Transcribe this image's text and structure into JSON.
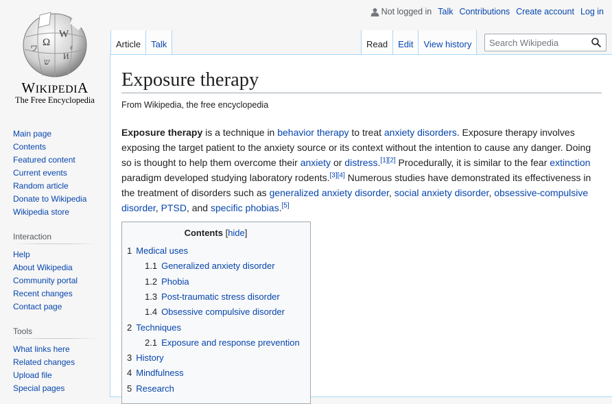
{
  "logo": {
    "wordmark_big": "Wikipedia",
    "wordmark_first": "W",
    "wordmark_rest": "IKIPEDI",
    "wordmark_last": "A",
    "tagline": "The Free Encyclopedia",
    "icon": "wikipedia-globe-icon"
  },
  "personal": {
    "not_logged_in": "Not logged in",
    "talk": "Talk",
    "contributions": "Contributions",
    "create_account": "Create account",
    "log_in": "Log in",
    "icon": "user-icon"
  },
  "tabs": {
    "article": "Article",
    "talk": "Talk",
    "read": "Read",
    "edit": "Edit",
    "view_history": "View history"
  },
  "search": {
    "placeholder": "Search Wikipedia",
    "icon": "search-icon"
  },
  "sidebar": {
    "navigation": [
      "Main page",
      "Contents",
      "Featured content",
      "Current events",
      "Random article",
      "Donate to Wikipedia",
      "Wikipedia store"
    ],
    "interaction_heading": "Interaction",
    "interaction": [
      "Help",
      "About Wikipedia",
      "Community portal",
      "Recent changes",
      "Contact page"
    ],
    "tools_heading": "Tools",
    "tools": [
      "What links here",
      "Related changes",
      "Upload file",
      "Special pages"
    ]
  },
  "article": {
    "title": "Exposure therapy",
    "site_sub": "From Wikipedia, the free encyclopedia",
    "lead": {
      "bold": "Exposure therapy",
      "t1": " is a technique in ",
      "l1": "behavior therapy",
      "t2": " to treat ",
      "l2": "anxiety disorders",
      "t3": ". Exposure therapy involves exposing the target patient to the anxiety source or its context without the intention to cause any danger. Doing so is thought to help them overcome their ",
      "l3": "anxiety",
      "t4": " or ",
      "l4": "distress",
      "t4b": ".",
      "r1": "[1]",
      "r2": "[2]",
      "t5": " Procedurally, it is similar to the fear ",
      "l5": "extinction",
      "t6": " paradigm developed studying laboratory rodents.",
      "r3": "[3]",
      "r4": "[4]",
      "t7": " Numerous studies have demonstrated its effectiveness in the treatment of disorders such as ",
      "l6": "generalized anxiety disorder",
      "t8": ", ",
      "l7": "social anxiety disorder",
      "t9": ", ",
      "l8": "obsessive-compulsive disorder",
      "t10": ", ",
      "l9": "PTSD",
      "t11": ", and ",
      "l10": "specific phobias",
      "t12": ".",
      "r5": "[5]"
    }
  },
  "toc": {
    "title": "Contents",
    "hide_open": "[",
    "hide": "hide",
    "hide_close": "]",
    "items": [
      {
        "num": "1",
        "label": "Medical uses",
        "level": 1
      },
      {
        "num": "1.1",
        "label": "Generalized anxiety disorder",
        "level": 2
      },
      {
        "num": "1.2",
        "label": "Phobia",
        "level": 2
      },
      {
        "num": "1.3",
        "label": "Post-traumatic stress disorder",
        "level": 2
      },
      {
        "num": "1.4",
        "label": "Obsessive compulsive disorder",
        "level": 2
      },
      {
        "num": "2",
        "label": "Techniques",
        "level": 1
      },
      {
        "num": "2.1",
        "label": "Exposure and response prevention",
        "level": 2
      },
      {
        "num": "3",
        "label": "History",
        "level": 1
      },
      {
        "num": "4",
        "label": "Mindfulness",
        "level": 1
      },
      {
        "num": "5",
        "label": "Research",
        "level": 1
      }
    ]
  }
}
